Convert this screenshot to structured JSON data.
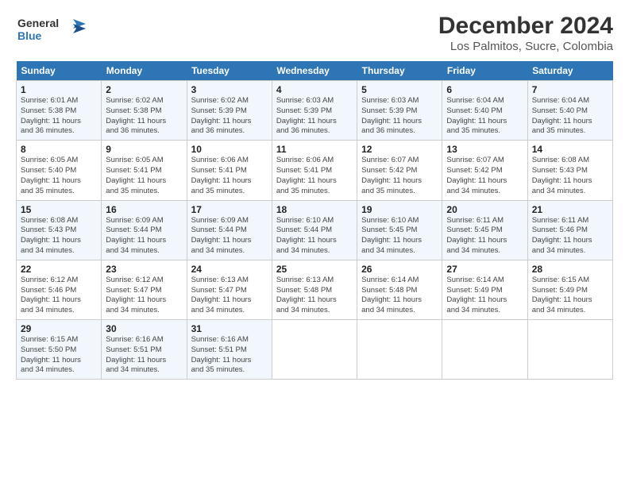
{
  "header": {
    "logo_line1": "General",
    "logo_line2": "Blue",
    "title": "December 2024",
    "subtitle": "Los Palmitos, Sucre, Colombia"
  },
  "days_of_week": [
    "Sunday",
    "Monday",
    "Tuesday",
    "Wednesday",
    "Thursday",
    "Friday",
    "Saturday"
  ],
  "weeks": [
    [
      {
        "day": "1",
        "info": "Sunrise: 6:01 AM\nSunset: 5:38 PM\nDaylight: 11 hours\nand 36 minutes."
      },
      {
        "day": "2",
        "info": "Sunrise: 6:02 AM\nSunset: 5:38 PM\nDaylight: 11 hours\nand 36 minutes."
      },
      {
        "day": "3",
        "info": "Sunrise: 6:02 AM\nSunset: 5:39 PM\nDaylight: 11 hours\nand 36 minutes."
      },
      {
        "day": "4",
        "info": "Sunrise: 6:03 AM\nSunset: 5:39 PM\nDaylight: 11 hours\nand 36 minutes."
      },
      {
        "day": "5",
        "info": "Sunrise: 6:03 AM\nSunset: 5:39 PM\nDaylight: 11 hours\nand 36 minutes."
      },
      {
        "day": "6",
        "info": "Sunrise: 6:04 AM\nSunset: 5:40 PM\nDaylight: 11 hours\nand 35 minutes."
      },
      {
        "day": "7",
        "info": "Sunrise: 6:04 AM\nSunset: 5:40 PM\nDaylight: 11 hours\nand 35 minutes."
      }
    ],
    [
      {
        "day": "8",
        "info": "Sunrise: 6:05 AM\nSunset: 5:40 PM\nDaylight: 11 hours\nand 35 minutes."
      },
      {
        "day": "9",
        "info": "Sunrise: 6:05 AM\nSunset: 5:41 PM\nDaylight: 11 hours\nand 35 minutes."
      },
      {
        "day": "10",
        "info": "Sunrise: 6:06 AM\nSunset: 5:41 PM\nDaylight: 11 hours\nand 35 minutes."
      },
      {
        "day": "11",
        "info": "Sunrise: 6:06 AM\nSunset: 5:41 PM\nDaylight: 11 hours\nand 35 minutes."
      },
      {
        "day": "12",
        "info": "Sunrise: 6:07 AM\nSunset: 5:42 PM\nDaylight: 11 hours\nand 35 minutes."
      },
      {
        "day": "13",
        "info": "Sunrise: 6:07 AM\nSunset: 5:42 PM\nDaylight: 11 hours\nand 34 minutes."
      },
      {
        "day": "14",
        "info": "Sunrise: 6:08 AM\nSunset: 5:43 PM\nDaylight: 11 hours\nand 34 minutes."
      }
    ],
    [
      {
        "day": "15",
        "info": "Sunrise: 6:08 AM\nSunset: 5:43 PM\nDaylight: 11 hours\nand 34 minutes."
      },
      {
        "day": "16",
        "info": "Sunrise: 6:09 AM\nSunset: 5:44 PM\nDaylight: 11 hours\nand 34 minutes."
      },
      {
        "day": "17",
        "info": "Sunrise: 6:09 AM\nSunset: 5:44 PM\nDaylight: 11 hours\nand 34 minutes."
      },
      {
        "day": "18",
        "info": "Sunrise: 6:10 AM\nSunset: 5:44 PM\nDaylight: 11 hours\nand 34 minutes."
      },
      {
        "day": "19",
        "info": "Sunrise: 6:10 AM\nSunset: 5:45 PM\nDaylight: 11 hours\nand 34 minutes."
      },
      {
        "day": "20",
        "info": "Sunrise: 6:11 AM\nSunset: 5:45 PM\nDaylight: 11 hours\nand 34 minutes."
      },
      {
        "day": "21",
        "info": "Sunrise: 6:11 AM\nSunset: 5:46 PM\nDaylight: 11 hours\nand 34 minutes."
      }
    ],
    [
      {
        "day": "22",
        "info": "Sunrise: 6:12 AM\nSunset: 5:46 PM\nDaylight: 11 hours\nand 34 minutes."
      },
      {
        "day": "23",
        "info": "Sunrise: 6:12 AM\nSunset: 5:47 PM\nDaylight: 11 hours\nand 34 minutes."
      },
      {
        "day": "24",
        "info": "Sunrise: 6:13 AM\nSunset: 5:47 PM\nDaylight: 11 hours\nand 34 minutes."
      },
      {
        "day": "25",
        "info": "Sunrise: 6:13 AM\nSunset: 5:48 PM\nDaylight: 11 hours\nand 34 minutes."
      },
      {
        "day": "26",
        "info": "Sunrise: 6:14 AM\nSunset: 5:48 PM\nDaylight: 11 hours\nand 34 minutes."
      },
      {
        "day": "27",
        "info": "Sunrise: 6:14 AM\nSunset: 5:49 PM\nDaylight: 11 hours\nand 34 minutes."
      },
      {
        "day": "28",
        "info": "Sunrise: 6:15 AM\nSunset: 5:49 PM\nDaylight: 11 hours\nand 34 minutes."
      }
    ],
    [
      {
        "day": "29",
        "info": "Sunrise: 6:15 AM\nSunset: 5:50 PM\nDaylight: 11 hours\nand 34 minutes."
      },
      {
        "day": "30",
        "info": "Sunrise: 6:16 AM\nSunset: 5:51 PM\nDaylight: 11 hours\nand 34 minutes."
      },
      {
        "day": "31",
        "info": "Sunrise: 6:16 AM\nSunset: 5:51 PM\nDaylight: 11 hours\nand 35 minutes."
      },
      {
        "day": "",
        "info": ""
      },
      {
        "day": "",
        "info": ""
      },
      {
        "day": "",
        "info": ""
      },
      {
        "day": "",
        "info": ""
      }
    ]
  ]
}
